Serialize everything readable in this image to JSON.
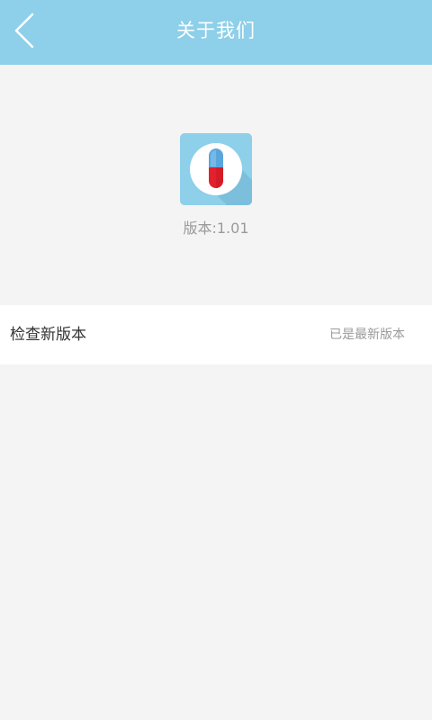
{
  "header": {
    "title": "关于我们",
    "back_icon": "chevron-left-icon",
    "background_color": "#8ecfe9"
  },
  "app": {
    "icon": "pill-capsule-icon",
    "version_text": "版本:1.01"
  },
  "update_row": {
    "label": "检查新版本",
    "status": "已是最新版本"
  },
  "colors": {
    "page_background": "#f4f4f4",
    "capsule_top": "#5aa6dc",
    "capsule_bottom": "#e3202b"
  }
}
